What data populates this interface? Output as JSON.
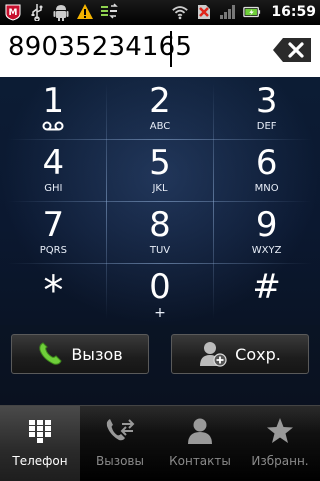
{
  "status_bar": {
    "time": "16:59",
    "icons_left": [
      "mcafee-icon",
      "usb-icon",
      "android-debug-icon",
      "warning-icon",
      "sync-icon"
    ],
    "icons_right": [
      "wifi-icon",
      "no-sim-icon",
      "signal-icon",
      "battery-icon"
    ],
    "battery_level": 0.6
  },
  "dialer": {
    "number": "89035234165"
  },
  "keypad": [
    {
      "digit": "1",
      "letters": "voicemail"
    },
    {
      "digit": "2",
      "letters": "ABC"
    },
    {
      "digit": "3",
      "letters": "DEF"
    },
    {
      "digit": "4",
      "letters": "GHI"
    },
    {
      "digit": "5",
      "letters": "JKL"
    },
    {
      "digit": "6",
      "letters": "MNO"
    },
    {
      "digit": "7",
      "letters": "PQRS"
    },
    {
      "digit": "8",
      "letters": "TUV"
    },
    {
      "digit": "9",
      "letters": "WXYZ"
    },
    {
      "digit": "*",
      "letters": ""
    },
    {
      "digit": "0",
      "letters": "+"
    },
    {
      "digit": "#",
      "letters": ""
    }
  ],
  "actions": {
    "call_label": "Вызов",
    "save_label": "Сохр."
  },
  "tabs": [
    {
      "label": "Телефон",
      "icon": "dialpad-icon",
      "active": true
    },
    {
      "label": "Вызовы",
      "icon": "call-log-icon",
      "active": false
    },
    {
      "label": "Контакты",
      "icon": "contacts-icon",
      "active": false
    },
    {
      "label": "Избранн.",
      "icon": "star-icon",
      "active": false
    }
  ],
  "colors": {
    "call_green": "#6fcf3a",
    "keypad_bg": "#0c1c34",
    "active_tab": "#3a3a3a"
  }
}
